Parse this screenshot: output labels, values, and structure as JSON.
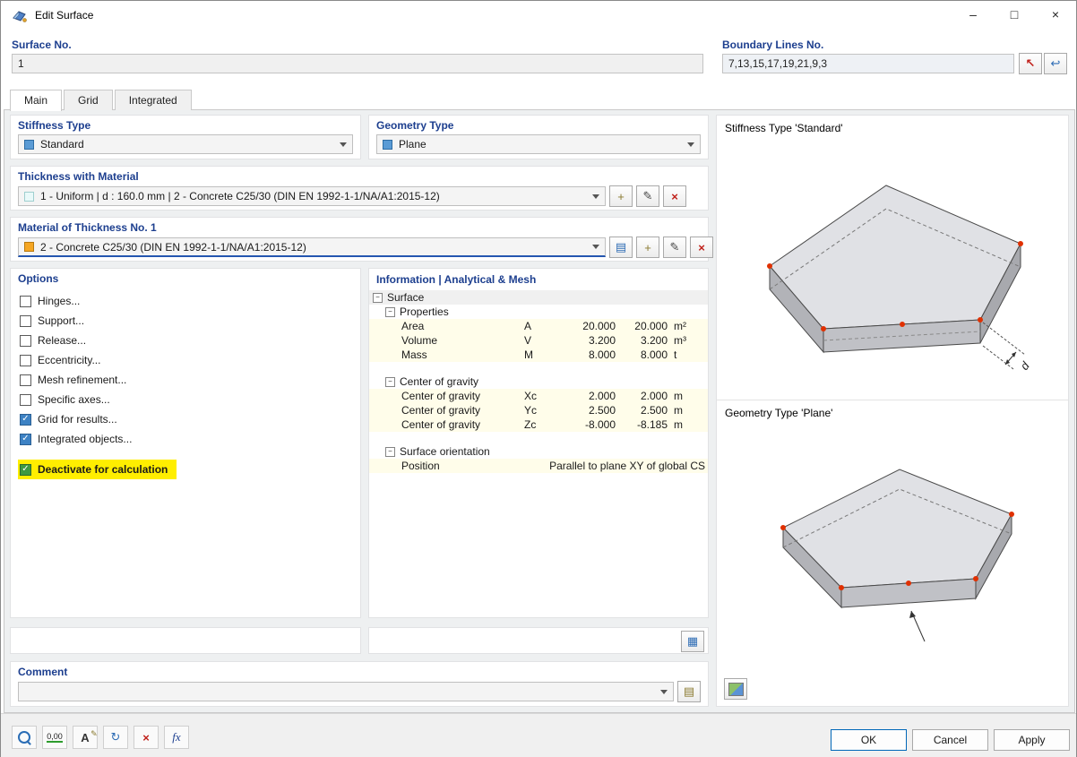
{
  "window": {
    "title": "Edit Surface"
  },
  "icons": {
    "minimize": "–",
    "maximize": "□",
    "close": "×",
    "select": "↖",
    "undo": "↩",
    "add": "+",
    "edit": "✎",
    "delete": "×",
    "library": "▤",
    "grid": "▦",
    "image": "▤",
    "expander": "−",
    "check": "✓",
    "units": "0,00",
    "rename": "A",
    "refresh": "↻",
    "fx": "fx"
  },
  "header": {
    "surface_no_label": "Surface No.",
    "surface_no_value": "1",
    "boundary_label": "Boundary Lines No.",
    "boundary_value": "7,13,15,17,19,21,9,3"
  },
  "tabs": {
    "main": "Main",
    "grid": "Grid",
    "integrated": "Integrated"
  },
  "stiffness": {
    "label": "Stiffness Type",
    "value": "Standard"
  },
  "geometry": {
    "label": "Geometry Type",
    "value": "Plane"
  },
  "thickness": {
    "label": "Thickness with Material",
    "value": "1 - Uniform | d : 160.0 mm | 2 - Concrete C25/30 (DIN EN 1992-1-1/NA/A1:2015-12)"
  },
  "material": {
    "label": "Material of Thickness No. 1",
    "value": "2 - Concrete C25/30 (DIN EN 1992-1-1/NA/A1:2015-12)"
  },
  "options": {
    "label": "Options",
    "items": [
      {
        "label": "Hinges...",
        "checked": false
      },
      {
        "label": "Support...",
        "checked": false
      },
      {
        "label": "Release...",
        "checked": false
      },
      {
        "label": "Eccentricity...",
        "checked": false
      },
      {
        "label": "Mesh refinement...",
        "checked": false
      },
      {
        "label": "Specific axes...",
        "checked": false
      },
      {
        "label": "Grid for results...",
        "checked": true
      },
      {
        "label": "Integrated objects...",
        "checked": true
      },
      {
        "label": "Deactivate for calculation",
        "checked": true,
        "highlighted": true
      }
    ]
  },
  "info": {
    "title": "Information | Analytical & Mesh",
    "rows": {
      "surface": "Surface",
      "properties": "Properties",
      "area": {
        "label": "Area",
        "sym": "A",
        "v1": "20.000",
        "v2": "20.000",
        "unit": "m²"
      },
      "volume": {
        "label": "Volume",
        "sym": "V",
        "v1": "3.200",
        "v2": "3.200",
        "unit": "m³"
      },
      "mass": {
        "label": "Mass",
        "sym": "M",
        "v1": "8.000",
        "v2": "8.000",
        "unit": "t"
      },
      "cog": "Center of gravity",
      "cog_x": {
        "label": "Center of gravity",
        "sym": "Xc",
        "v1": "2.000",
        "v2": "2.000",
        "unit": "m"
      },
      "cog_y": {
        "label": "Center of gravity",
        "sym": "Yc",
        "v1": "2.500",
        "v2": "2.500",
        "unit": "m"
      },
      "cog_z": {
        "label": "Center of gravity",
        "sym": "Zc",
        "v1": "-8.000",
        "v2": "-8.185",
        "unit": "m"
      },
      "orientation": "Surface orientation",
      "position": {
        "label": "Position",
        "value": "Parallel to plane XY of global CS"
      }
    }
  },
  "comment": {
    "label": "Comment",
    "value": ""
  },
  "preview": {
    "stiffness_caption": "Stiffness Type 'Standard'",
    "geometry_caption": "Geometry Type 'Plane'",
    "dim_label": "d"
  },
  "footer": {
    "ok": "OK",
    "cancel": "Cancel",
    "apply": "Apply"
  }
}
